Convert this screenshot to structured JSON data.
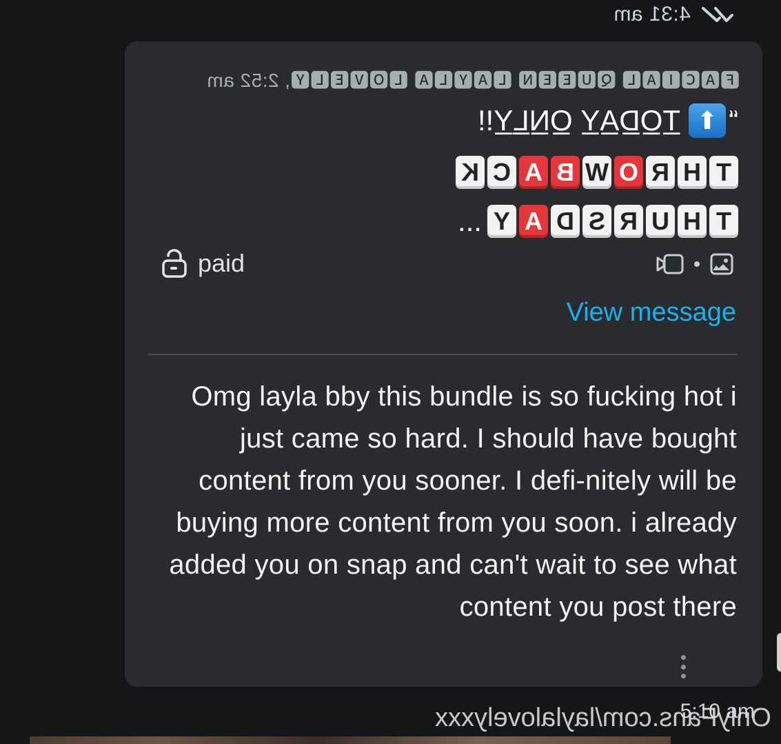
{
  "chat": {
    "top_time": "4:31 am",
    "bottom_time": "5:10 am"
  },
  "quote": {
    "author": "🅵🅰🅲🅸🅰🅻 🆀🆄🅴🅴🅽 🅻🅰🆈🅻🅰 🅻🅾🆅🅴🅻🆈, 2:52 am",
    "line1_prefix": "“",
    "line1_text": "T̲O̲D̲A̲Y̲ O̲N̲L̲Y̲!!",
    "line2_letters": [
      "T",
      "H",
      "R",
      "O",
      "W",
      "B",
      "A",
      "C",
      "K"
    ],
    "line2_red": [
      false,
      false,
      false,
      true,
      false,
      true,
      true,
      false,
      false
    ],
    "line3_letters": [
      "T",
      "H",
      "U",
      "R",
      "S",
      "D",
      "A",
      "Y"
    ],
    "line3_red": [
      false,
      false,
      false,
      false,
      false,
      false,
      true,
      false
    ],
    "line3_suffix": "..."
  },
  "attachment": {
    "paid_label": "paid",
    "view_message": "View message"
  },
  "message": {
    "text": "Omg layla bby this bundle is so fucking hot i just came so hard. I should have bought content from you sooner. I defi-nitely will be buying more content from you soon. i already added you on snap and can't wait to see what content you post there"
  },
  "watermark": {
    "text": "OnlyFans.com/laylalovelyxxx"
  },
  "colors": {
    "background": "#151618",
    "bubble": "#2a2b2f",
    "link": "#19b1ee",
    "red_tile": "#e6363b"
  },
  "icons": [
    "double-check-icon",
    "unlock-icon",
    "image-icon",
    "video-icon",
    "kebab-menu-icon",
    "up-arrow-icon"
  ]
}
